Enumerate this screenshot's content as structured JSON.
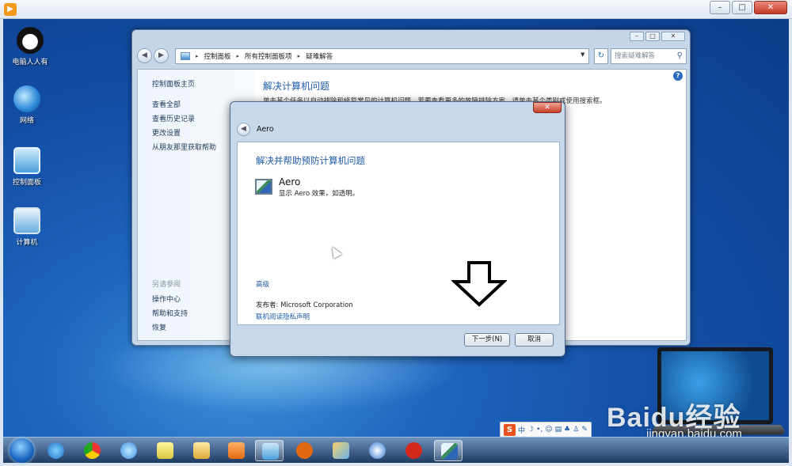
{
  "player": {
    "title": ""
  },
  "desktop_icons": [
    {
      "label": "电脑人人有"
    },
    {
      "label": "网络"
    },
    {
      "label": "控制面板"
    },
    {
      "label": "计算机"
    }
  ],
  "control_panel": {
    "breadcrumb": [
      "控制面板",
      "所有控制面板项",
      "疑难解答"
    ],
    "search_placeholder": "搜索疑难解答",
    "sidebar_links": [
      "控制面板主页",
      "查看全部",
      "查看历史记录",
      "更改设置",
      "从朋友那里获取帮助"
    ],
    "see_also_title": "另请参阅",
    "see_also_links": [
      "操作中心",
      "帮助和支持",
      "恢复"
    ],
    "main_title": "解决计算机问题",
    "main_desc": "单击某个任务以自动排除和修复常见的计算机问题。若要查看更多的故障排除方案，请单击某个类别或使用搜索框。"
  },
  "dialog": {
    "title": "Aero",
    "heading": "解决并帮助预防计算机问题",
    "item_name": "Aero",
    "item_desc": "显示 Aero 效果，如透明。",
    "advanced_link": "高级",
    "publisher": "发布者:  Microsoft Corporation",
    "privacy_link": "联机阅读隐私声明",
    "next_button": "下一步(N)",
    "cancel_button": "取消"
  },
  "ime_bar": {
    "logo": "S",
    "mode": "中"
  },
  "watermark": {
    "brand": "Baidu经验",
    "url": "jingyan.baidu.com"
  },
  "colors": {
    "accent": "#1e5ba8",
    "desktop": "#134fa6"
  }
}
